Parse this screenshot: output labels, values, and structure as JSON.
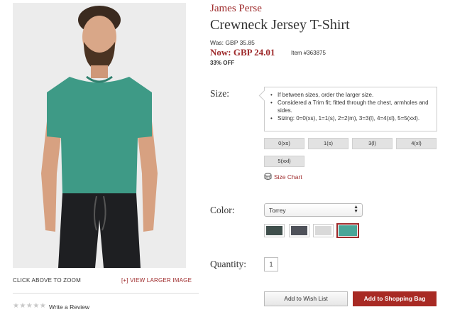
{
  "product": {
    "brand": "James Perse",
    "title": "Crewneck Jersey T-Shirt",
    "was_price": "Was: GBP 35.85",
    "now_price": "Now: GBP 24.01",
    "item_number": "Item #363875",
    "discount": "33% OFF"
  },
  "image_area": {
    "zoom_text": "CLICK ABOVE TO ZOOM",
    "larger_link": "[+] VIEW LARGER IMAGE",
    "stars": "★★★★★",
    "review_link": "Write a Review"
  },
  "size": {
    "label": "Size:",
    "tips": [
      "If between sizes, order the larger size.",
      "Considered a Trim fit; fitted through the chest, armholes and sides.",
      "Sizing: 0=0(xs), 1=1(s), 2=2(m), 3=3(l), 4=4(xl), 5=5(xxl)."
    ],
    "options": [
      "0(xs)",
      "1(s)",
      "3(l)",
      "4(xl)",
      "5(xxl)"
    ],
    "chart_link": "Size Chart"
  },
  "color": {
    "label": "Color:",
    "selected": "Torrey",
    "swatches": [
      {
        "name": "dark-green",
        "hex": "#3f4f4c"
      },
      {
        "name": "charcoal",
        "hex": "#4f525a"
      },
      {
        "name": "light-grey",
        "hex": "#d9d9d9"
      },
      {
        "name": "torrey",
        "hex": "#4aa598"
      }
    ]
  },
  "quantity": {
    "label": "Quantity:",
    "value": "1"
  },
  "actions": {
    "wish_list": "Add to Wish List",
    "shopping_bag": "Add to Shopping Bag"
  },
  "colors": {
    "accent": "#9e2a2b",
    "bag_button": "#a82a24",
    "shirt": "#3e9a86"
  }
}
